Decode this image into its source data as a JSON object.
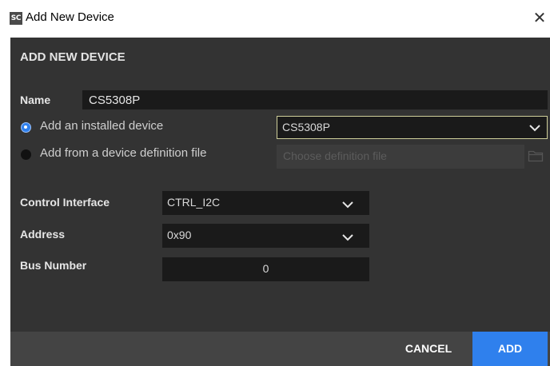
{
  "window": {
    "app_icon_text": "SC",
    "title": "Add New Device",
    "close_glyph": "✕"
  },
  "dialog": {
    "header": "ADD NEW DEVICE",
    "name_label": "Name",
    "name_value": "CS5308P",
    "source_options": {
      "installed": {
        "label": "Add an installed device",
        "selected": true
      },
      "definition_file": {
        "label": "Add from a device definition file",
        "selected": false
      }
    },
    "installed_device_select": {
      "value": "CS5308P"
    },
    "definition_file_input": {
      "placeholder": "Choose definition file",
      "icon": "folder-icon"
    },
    "control_interface": {
      "label": "Control Interface",
      "value": "CTRL_I2C"
    },
    "address": {
      "label": "Address",
      "value": "0x90"
    },
    "bus_number": {
      "label": "Bus Number",
      "value": "0"
    }
  },
  "footer": {
    "cancel_label": "CANCEL",
    "add_label": "ADD"
  },
  "colors": {
    "dialog_bg": "#333333",
    "field_bg": "#1a1a1a",
    "footer_bg": "#444444",
    "accent": "#2f80ed",
    "select_border": "#cfcf9a"
  }
}
